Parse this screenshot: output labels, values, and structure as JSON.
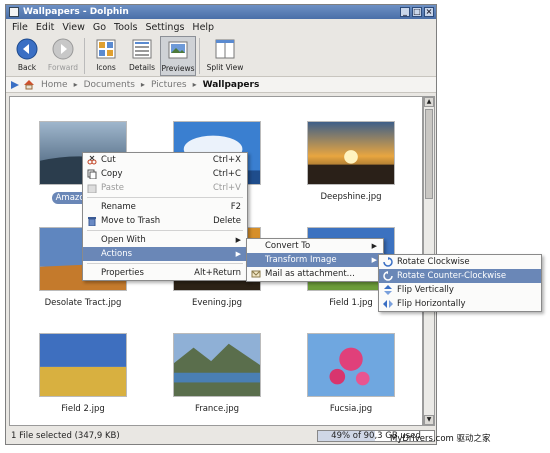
{
  "window": {
    "title": "Wallpapers - Dolphin"
  },
  "menubar": [
    "File",
    "Edit",
    "View",
    "Go",
    "Tools",
    "Settings",
    "Help"
  ],
  "toolbar": {
    "back": "Back",
    "forward": "Forward",
    "icons": "Icons",
    "details": "Details",
    "previews": "Previews",
    "split": "Split View"
  },
  "breadcrumb": [
    "Home",
    "Documents",
    "Pictures",
    "Wallpapers"
  ],
  "files": [
    {
      "name": "Amazon Fo...",
      "selected": true
    },
    {
      "name": ""
    },
    {
      "name": "Deepshine.jpg"
    },
    {
      "name": "Desolate Tract.jpg"
    },
    {
      "name": "Evening.jpg"
    },
    {
      "name": "Field 1.jpg"
    },
    {
      "name": "Field 2.jpg"
    },
    {
      "name": "France.jpg"
    },
    {
      "name": "Fucsia.jpg"
    }
  ],
  "context_menu": {
    "cut": "Cut",
    "cut_key": "Ctrl+X",
    "copy": "Copy",
    "copy_key": "Ctrl+C",
    "paste": "Paste",
    "paste_key": "Ctrl+V",
    "rename": "Rename",
    "rename_key": "F2",
    "trash": "Move to Trash",
    "trash_key": "Delete",
    "open_with": "Open With",
    "actions": "Actions",
    "properties": "Properties",
    "properties_key": "Alt+Return"
  },
  "actions_menu": {
    "convert": "Convert To",
    "transform": "Transform Image",
    "mail": "Mail as attachment..."
  },
  "transform_menu": {
    "rot_cw": "Rotate Clockwise",
    "rot_ccw": "Rotate Counter-Clockwise",
    "flip_v": "Flip Vertically",
    "flip_h": "Flip Horizontally"
  },
  "status": {
    "selection": "1 File selected (347,9 KB)",
    "disk": "49% of 90,3 GB used",
    "disk_fraction": 0.49
  },
  "watermark": "MyDrivers.com 驱动之家"
}
